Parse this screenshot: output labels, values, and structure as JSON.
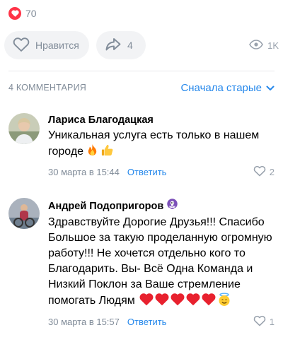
{
  "post": {
    "reactions_count": "70",
    "like_label": "Нравится",
    "shares_count": "4",
    "views": "1K"
  },
  "comments_header": {
    "count_label": "4 КОММЕНТАРИЯ",
    "sort_label": "Сначала старые"
  },
  "comments": [
    {
      "author": "Лариса Благодацкая",
      "text": "Уникальная услуга есть только в нашем городе",
      "emoji": [
        "fire",
        "thumbs-up"
      ],
      "date": "30 марта в 15:44",
      "reply_label": "Ответить",
      "likes": "2"
    },
    {
      "author": "Андрей Подопригоров",
      "author_badge": "pirate-flag",
      "text": "Здравствуйте Дорогие Друзья!!! Спасибо Большое за такую проделанную огромную работу!!! Не хочется отдельно кого то Благодарить. Вы- Всё Одна Команда и Низкий Поклон за Ваше стремление помогать Людям",
      "emoji": [
        "red-heart",
        "red-heart",
        "red-heart",
        "red-heart",
        "red-heart",
        "smiling-face-with-halo"
      ],
      "date": "30 марта в 15:57",
      "reply_label": "Ответить",
      "likes": "1"
    }
  ],
  "colors": {
    "accent": "#2688eb",
    "reaction_red": "#ff3347",
    "secondary_text": "#818c99",
    "pill_bg": "#f2f3f5"
  }
}
